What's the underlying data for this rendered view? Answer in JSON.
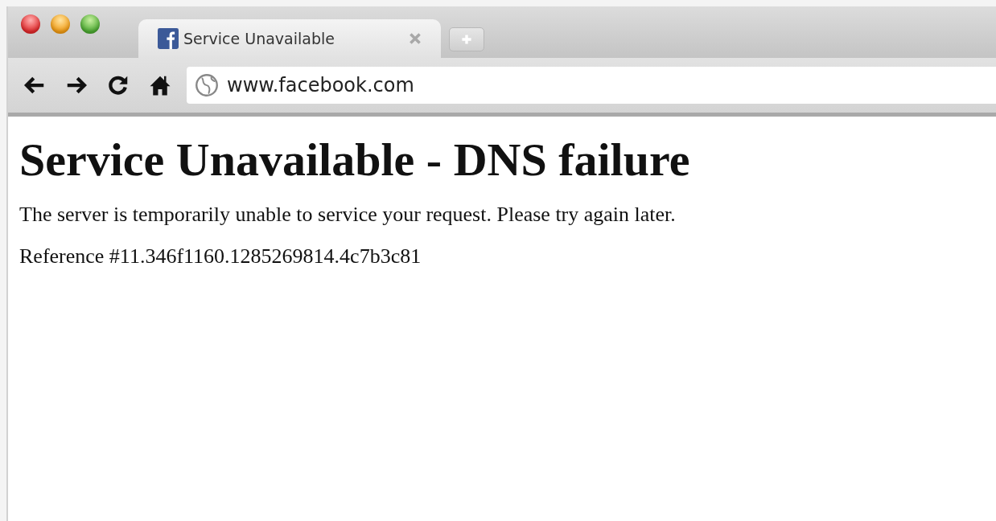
{
  "tabs": [
    {
      "title": "Service Unavailable",
      "selected": true
    }
  ],
  "address_bar": {
    "url": "www.facebook.com"
  },
  "page": {
    "heading": "Service Unavailable - DNS failure",
    "paragraphs": [
      "The server is temporarily unable to service your request. Please try again later.",
      "Reference #11.346f1160.1285269814.4c7b3c81"
    ]
  }
}
